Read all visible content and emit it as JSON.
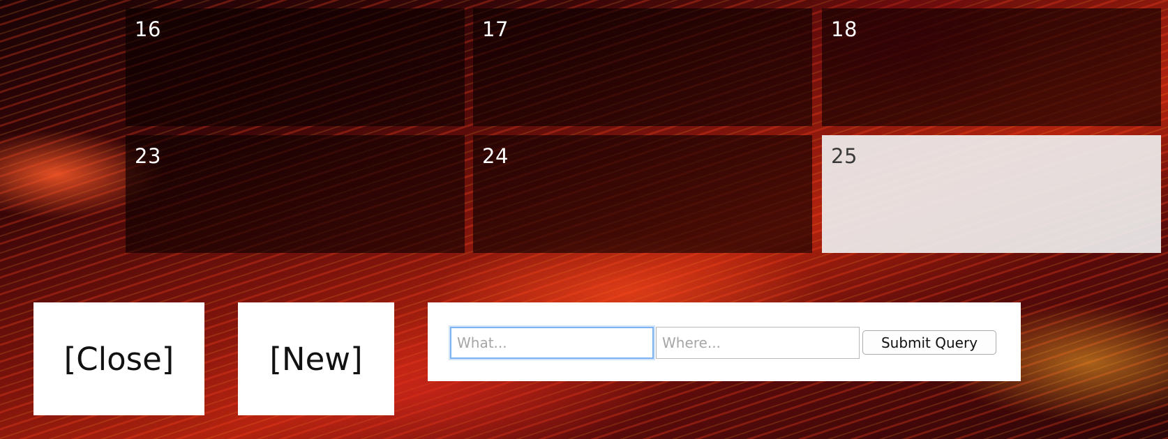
{
  "calendar": {
    "days": [
      {
        "label": "16",
        "highlighted": false
      },
      {
        "label": "17",
        "highlighted": false
      },
      {
        "label": "18",
        "highlighted": false
      },
      {
        "label": "23",
        "highlighted": false
      },
      {
        "label": "24",
        "highlighted": false
      },
      {
        "label": "25",
        "highlighted": true
      }
    ]
  },
  "actions": {
    "close_label": "[Close]",
    "new_label": "[New]"
  },
  "search": {
    "what_placeholder": "What...",
    "where_placeholder": "Where...",
    "what_value": "",
    "where_value": "",
    "submit_label": "Submit Query"
  },
  "colors": {
    "cell_dark": "#0a0000",
    "cell_highlight": "#eeeeee",
    "focus_ring": "#7fb2f2"
  }
}
